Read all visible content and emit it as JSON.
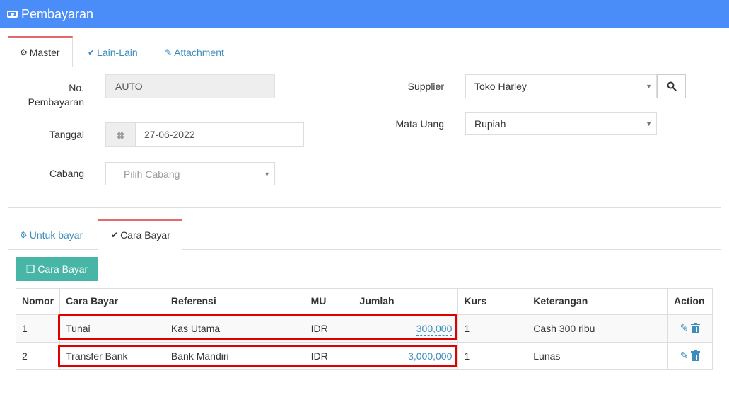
{
  "window": {
    "title": "Pembayaran"
  },
  "tabs_top": [
    {
      "label": "Master",
      "icon": "gears-icon"
    },
    {
      "label": "Lain-Lain",
      "icon": "check-circle-icon"
    },
    {
      "label": "Attachment",
      "icon": "paperclip-icon"
    }
  ],
  "form": {
    "no_pembayaran": {
      "label_line1": "No.",
      "label_line2": "Pembayaran",
      "value": "AUTO"
    },
    "tanggal": {
      "label": "Tanggal",
      "value": "27-06-2022"
    },
    "cabang": {
      "label": "Cabang",
      "placeholder": "Pilih Cabang"
    },
    "supplier": {
      "label": "Supplier",
      "value": "Toko Harley"
    },
    "mata_uang": {
      "label": "Mata Uang",
      "value": "Rupiah"
    }
  },
  "tabs_bottom": [
    {
      "label": "Untuk bayar",
      "icon": "gears-icon"
    },
    {
      "label": "Cara Bayar",
      "icon": "check-circle-icon"
    }
  ],
  "add_button": {
    "label": "Cara Bayar"
  },
  "table": {
    "headers": [
      "Nomor",
      "Cara Bayar",
      "Referensi",
      "MU",
      "Jumlah",
      "Kurs",
      "Keterangan",
      "Action"
    ],
    "rows": [
      {
        "nomor": "1",
        "cara_bayar": "Tunai",
        "referensi": "Kas Utama",
        "mu": "IDR",
        "jumlah": "300,000",
        "kurs": "1",
        "keterangan": "Cash 300 ribu"
      },
      {
        "nomor": "2",
        "cara_bayar": "Transfer Bank",
        "referensi": "Bank Mandiri",
        "mu": "IDR",
        "jumlah": "3,000,000",
        "kurs": "1",
        "keterangan": "Lunas"
      }
    ]
  },
  "colors": {
    "title_bar": "#4b8df8",
    "accent_tab": "#e26a6a",
    "button": "#48b6a6",
    "link": "#3c8dbc",
    "highlight": "#e00000"
  }
}
